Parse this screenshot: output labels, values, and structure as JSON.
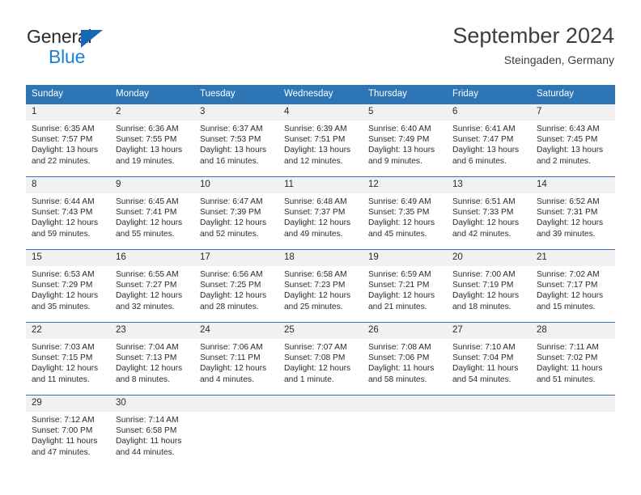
{
  "brand": {
    "name_part1": "General",
    "name_part2": "Blue",
    "flag_icon": "triangle-flag-icon",
    "color_dark": "#2b2b2b",
    "color_blue": "#1b7fd4"
  },
  "header": {
    "title": "September 2024",
    "subtitle": "Steingaden, Germany"
  },
  "calendar": {
    "header_bg": "#2e75b6",
    "daynum_bg": "#f1f1f1",
    "weekdays": [
      "Sunday",
      "Monday",
      "Tuesday",
      "Wednesday",
      "Thursday",
      "Friday",
      "Saturday"
    ],
    "weeks": [
      [
        {
          "day": "1",
          "sunrise": "Sunrise: 6:35 AM",
          "sunset": "Sunset: 7:57 PM",
          "daylight_line1": "Daylight: 13 hours",
          "daylight_line2": "and 22 minutes."
        },
        {
          "day": "2",
          "sunrise": "Sunrise: 6:36 AM",
          "sunset": "Sunset: 7:55 PM",
          "daylight_line1": "Daylight: 13 hours",
          "daylight_line2": "and 19 minutes."
        },
        {
          "day": "3",
          "sunrise": "Sunrise: 6:37 AM",
          "sunset": "Sunset: 7:53 PM",
          "daylight_line1": "Daylight: 13 hours",
          "daylight_line2": "and 16 minutes."
        },
        {
          "day": "4",
          "sunrise": "Sunrise: 6:39 AM",
          "sunset": "Sunset: 7:51 PM",
          "daylight_line1": "Daylight: 13 hours",
          "daylight_line2": "and 12 minutes."
        },
        {
          "day": "5",
          "sunrise": "Sunrise: 6:40 AM",
          "sunset": "Sunset: 7:49 PM",
          "daylight_line1": "Daylight: 13 hours",
          "daylight_line2": "and 9 minutes."
        },
        {
          "day": "6",
          "sunrise": "Sunrise: 6:41 AM",
          "sunset": "Sunset: 7:47 PM",
          "daylight_line1": "Daylight: 13 hours",
          "daylight_line2": "and 6 minutes."
        },
        {
          "day": "7",
          "sunrise": "Sunrise: 6:43 AM",
          "sunset": "Sunset: 7:45 PM",
          "daylight_line1": "Daylight: 13 hours",
          "daylight_line2": "and 2 minutes."
        }
      ],
      [
        {
          "day": "8",
          "sunrise": "Sunrise: 6:44 AM",
          "sunset": "Sunset: 7:43 PM",
          "daylight_line1": "Daylight: 12 hours",
          "daylight_line2": "and 59 minutes."
        },
        {
          "day": "9",
          "sunrise": "Sunrise: 6:45 AM",
          "sunset": "Sunset: 7:41 PM",
          "daylight_line1": "Daylight: 12 hours",
          "daylight_line2": "and 55 minutes."
        },
        {
          "day": "10",
          "sunrise": "Sunrise: 6:47 AM",
          "sunset": "Sunset: 7:39 PM",
          "daylight_line1": "Daylight: 12 hours",
          "daylight_line2": "and 52 minutes."
        },
        {
          "day": "11",
          "sunrise": "Sunrise: 6:48 AM",
          "sunset": "Sunset: 7:37 PM",
          "daylight_line1": "Daylight: 12 hours",
          "daylight_line2": "and 49 minutes."
        },
        {
          "day": "12",
          "sunrise": "Sunrise: 6:49 AM",
          "sunset": "Sunset: 7:35 PM",
          "daylight_line1": "Daylight: 12 hours",
          "daylight_line2": "and 45 minutes."
        },
        {
          "day": "13",
          "sunrise": "Sunrise: 6:51 AM",
          "sunset": "Sunset: 7:33 PM",
          "daylight_line1": "Daylight: 12 hours",
          "daylight_line2": "and 42 minutes."
        },
        {
          "day": "14",
          "sunrise": "Sunrise: 6:52 AM",
          "sunset": "Sunset: 7:31 PM",
          "daylight_line1": "Daylight: 12 hours",
          "daylight_line2": "and 39 minutes."
        }
      ],
      [
        {
          "day": "15",
          "sunrise": "Sunrise: 6:53 AM",
          "sunset": "Sunset: 7:29 PM",
          "daylight_line1": "Daylight: 12 hours",
          "daylight_line2": "and 35 minutes."
        },
        {
          "day": "16",
          "sunrise": "Sunrise: 6:55 AM",
          "sunset": "Sunset: 7:27 PM",
          "daylight_line1": "Daylight: 12 hours",
          "daylight_line2": "and 32 minutes."
        },
        {
          "day": "17",
          "sunrise": "Sunrise: 6:56 AM",
          "sunset": "Sunset: 7:25 PM",
          "daylight_line1": "Daylight: 12 hours",
          "daylight_line2": "and 28 minutes."
        },
        {
          "day": "18",
          "sunrise": "Sunrise: 6:58 AM",
          "sunset": "Sunset: 7:23 PM",
          "daylight_line1": "Daylight: 12 hours",
          "daylight_line2": "and 25 minutes."
        },
        {
          "day": "19",
          "sunrise": "Sunrise: 6:59 AM",
          "sunset": "Sunset: 7:21 PM",
          "daylight_line1": "Daylight: 12 hours",
          "daylight_line2": "and 21 minutes."
        },
        {
          "day": "20",
          "sunrise": "Sunrise: 7:00 AM",
          "sunset": "Sunset: 7:19 PM",
          "daylight_line1": "Daylight: 12 hours",
          "daylight_line2": "and 18 minutes."
        },
        {
          "day": "21",
          "sunrise": "Sunrise: 7:02 AM",
          "sunset": "Sunset: 7:17 PM",
          "daylight_line1": "Daylight: 12 hours",
          "daylight_line2": "and 15 minutes."
        }
      ],
      [
        {
          "day": "22",
          "sunrise": "Sunrise: 7:03 AM",
          "sunset": "Sunset: 7:15 PM",
          "daylight_line1": "Daylight: 12 hours",
          "daylight_line2": "and 11 minutes."
        },
        {
          "day": "23",
          "sunrise": "Sunrise: 7:04 AM",
          "sunset": "Sunset: 7:13 PM",
          "daylight_line1": "Daylight: 12 hours",
          "daylight_line2": "and 8 minutes."
        },
        {
          "day": "24",
          "sunrise": "Sunrise: 7:06 AM",
          "sunset": "Sunset: 7:11 PM",
          "daylight_line1": "Daylight: 12 hours",
          "daylight_line2": "and 4 minutes."
        },
        {
          "day": "25",
          "sunrise": "Sunrise: 7:07 AM",
          "sunset": "Sunset: 7:08 PM",
          "daylight_line1": "Daylight: 12 hours",
          "daylight_line2": "and 1 minute."
        },
        {
          "day": "26",
          "sunrise": "Sunrise: 7:08 AM",
          "sunset": "Sunset: 7:06 PM",
          "daylight_line1": "Daylight: 11 hours",
          "daylight_line2": "and 58 minutes."
        },
        {
          "day": "27",
          "sunrise": "Sunrise: 7:10 AM",
          "sunset": "Sunset: 7:04 PM",
          "daylight_line1": "Daylight: 11 hours",
          "daylight_line2": "and 54 minutes."
        },
        {
          "day": "28",
          "sunrise": "Sunrise: 7:11 AM",
          "sunset": "Sunset: 7:02 PM",
          "daylight_line1": "Daylight: 11 hours",
          "daylight_line2": "and 51 minutes."
        }
      ],
      [
        {
          "day": "29",
          "sunrise": "Sunrise: 7:12 AM",
          "sunset": "Sunset: 7:00 PM",
          "daylight_line1": "Daylight: 11 hours",
          "daylight_line2": "and 47 minutes."
        },
        {
          "day": "30",
          "sunrise": "Sunrise: 7:14 AM",
          "sunset": "Sunset: 6:58 PM",
          "daylight_line1": "Daylight: 11 hours",
          "daylight_line2": "and 44 minutes."
        },
        {
          "day": "",
          "sunrise": "",
          "sunset": "",
          "daylight_line1": "",
          "daylight_line2": ""
        },
        {
          "day": "",
          "sunrise": "",
          "sunset": "",
          "daylight_line1": "",
          "daylight_line2": ""
        },
        {
          "day": "",
          "sunrise": "",
          "sunset": "",
          "daylight_line1": "",
          "daylight_line2": ""
        },
        {
          "day": "",
          "sunrise": "",
          "sunset": "",
          "daylight_line1": "",
          "daylight_line2": ""
        },
        {
          "day": "",
          "sunrise": "",
          "sunset": "",
          "daylight_line1": "",
          "daylight_line2": ""
        }
      ]
    ]
  }
}
